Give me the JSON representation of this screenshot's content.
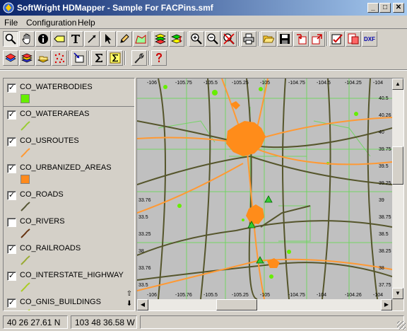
{
  "window": {
    "title": "SoftWright HDMapper - Sample For FACPins.smf",
    "minimize": "_",
    "maximize": "□",
    "close": "✕"
  },
  "menu": [
    "File",
    "Configuration",
    "Help"
  ],
  "toolbar_row1": [
    {
      "icon": "zoom-tool-icon",
      "pressed": true
    },
    {
      "icon": "pan-hand-icon"
    },
    {
      "icon": "info-icon"
    },
    {
      "icon": "label-tool-icon"
    },
    {
      "icon": "text-tool-icon"
    },
    {
      "icon": "line-tool-icon"
    },
    {
      "icon": "arrow-select-icon"
    },
    {
      "icon": "pencil-icon"
    },
    {
      "icon": "area-tool-icon"
    },
    {
      "icon": "layers-icon"
    },
    {
      "icon": "layer-order-icon"
    },
    {
      "icon": "zoom-in-icon"
    },
    {
      "icon": "zoom-out-icon"
    },
    {
      "icon": "zoom-cancel-icon"
    },
    {
      "icon": "print-icon"
    },
    {
      "icon": "open-folder-icon"
    },
    {
      "icon": "save-icon"
    },
    {
      "icon": "import-icon"
    },
    {
      "icon": "export-icon"
    },
    {
      "icon": "check-properties-icon"
    },
    {
      "icon": "dbf-icon"
    },
    {
      "icon": "dxf-icon",
      "label": "DXF"
    }
  ],
  "toolbar_row2": [
    {
      "icon": "add-layer-icon"
    },
    {
      "icon": "layer-stack-icon"
    },
    {
      "icon": "open-layers-icon"
    },
    {
      "icon": "points-icon"
    },
    {
      "icon": "locate-icon"
    },
    {
      "icon": "sigma-icon"
    },
    {
      "icon": "sigma-select-icon"
    },
    {
      "icon": "tools-wrench-icon"
    },
    {
      "icon": "help-icon"
    }
  ],
  "layers": [
    {
      "name": "CO_WATERBODIES",
      "checked": true,
      "swatch": "#66ee00",
      "kind": "fill"
    },
    {
      "name": "CO_WATERAREAS",
      "checked": true,
      "swatch": "#99cc33",
      "kind": "line"
    },
    {
      "name": "CO_USROUTES",
      "checked": true,
      "swatch": "#ff9933",
      "kind": "line"
    },
    {
      "name": "CO_URBANIZED_AREAS",
      "checked": true,
      "swatch": "#ff8a1c",
      "kind": "fill"
    },
    {
      "name": "CO_ROADS",
      "checked": true,
      "swatch": "#555533",
      "kind": "line"
    },
    {
      "name": "CO_RIVERS",
      "checked": false,
      "swatch": "#663311",
      "kind": "line"
    },
    {
      "name": "CO_RAILROADS",
      "checked": true,
      "swatch": "#99aa33",
      "kind": "line"
    },
    {
      "name": "CO_INTERSTATE_HIGHWAY",
      "checked": true,
      "swatch": "#aacc22",
      "kind": "line"
    },
    {
      "name": "CO_GNIS_BUILDINGS",
      "checked": true,
      "swatch": "#aacc22",
      "kind": "line"
    }
  ],
  "map": {
    "top_labels": [
      "-106",
      "-105.75",
      "-105.5",
      "-105.25",
      "-105",
      "-104.75",
      "-104.5",
      "-104.25",
      "-104"
    ],
    "bottom_labels": [
      "-106",
      "-105.76",
      "-105.5",
      "-105.25",
      "-105",
      "-104.75",
      "-104",
      "-104.26",
      "-104"
    ],
    "left_labels": [
      "",
      "",
      "",
      "",
      "",
      "",
      "33.76",
      "33.5",
      "33.25",
      "38",
      "33.76",
      "33.5"
    ],
    "right_labels": [
      "40.5",
      "40.26",
      "40",
      "39.75",
      "39.5",
      "39.25",
      "39",
      "38.75",
      "38.5",
      "38.25",
      "38",
      "37.75"
    ],
    "colors": {
      "background": "#c0c0c0",
      "urban": "#ff8c1a",
      "roads": "#55552b",
      "routes": "#ff9933",
      "water": "#66ee00",
      "boundaries": "#6ad65a"
    }
  },
  "status": {
    "latitude": "40 26 27.61 N",
    "longitude": "103 48 36.58 W"
  }
}
